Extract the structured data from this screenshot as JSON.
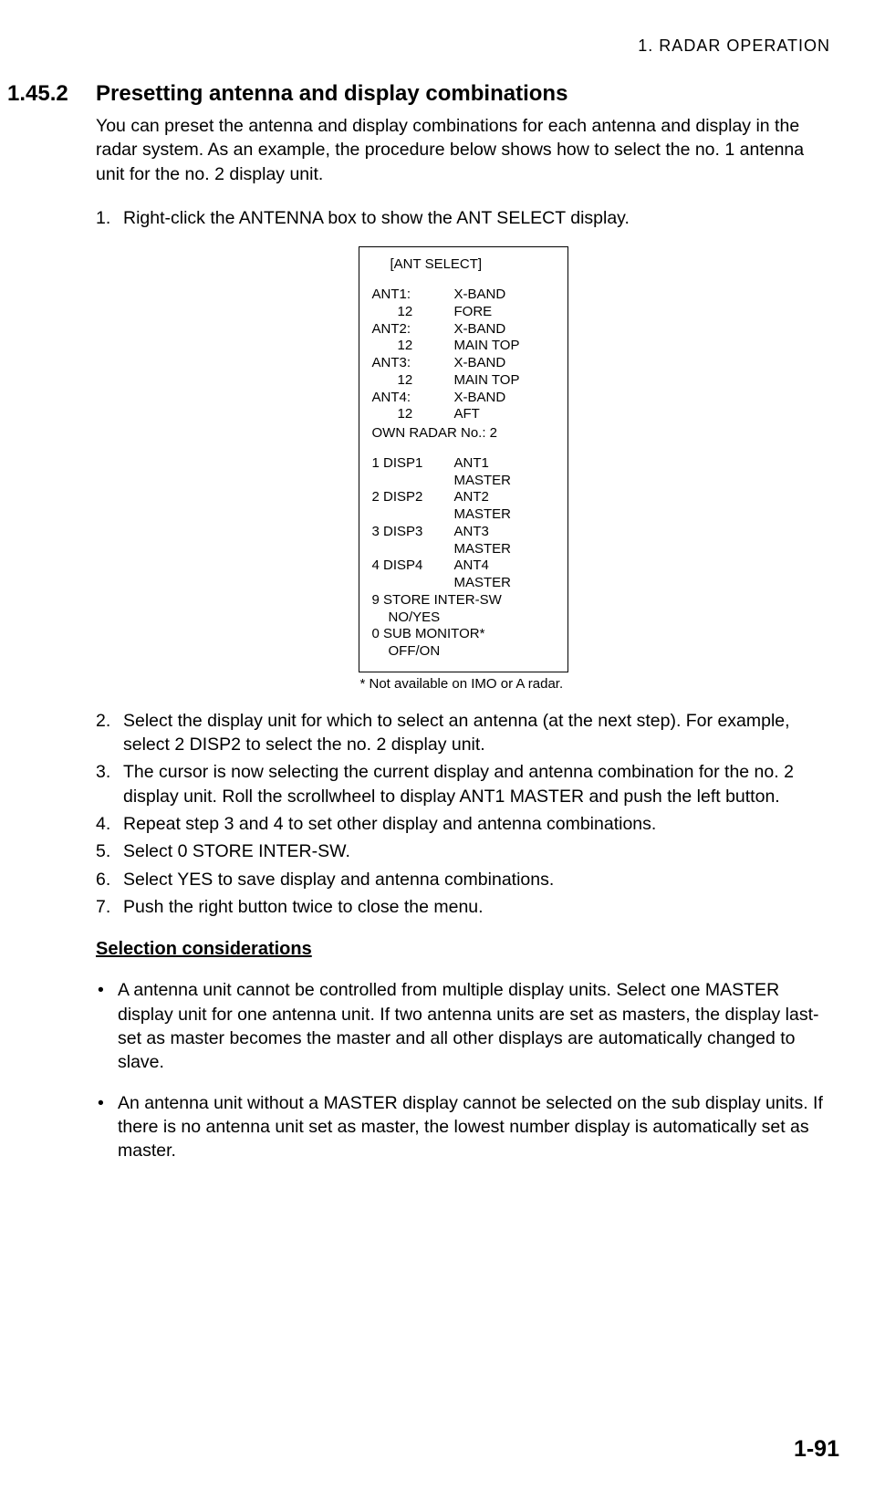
{
  "header": "1.  RADAR  OPERATION",
  "section": {
    "number": "1.45.2",
    "title": "Presetting antenna and display combinations"
  },
  "intro": "You can preset the antenna and display combinations for each antenna and display in the radar system. As an example, the procedure below shows how to select the no. 1 antenna unit for the no. 2 display unit.",
  "steps": [
    "Right-click the ANTENNA box to show the ANT SELECT display.",
    "Select the display unit for which to select an antenna (at the next step). For example, select 2 DISP2 to select the no. 2 display unit.",
    "The cursor is now selecting the current display and antenna combination for the no. 2 display unit. Roll the scrollwheel to display ANT1 MASTER and push the left button.",
    "Repeat step 3 and 4 to set other display and antenna combinations.",
    "Select 0 STORE INTER-SW.",
    "Select YES to save display and antenna combinations.",
    "Push the right button twice to close the menu."
  ],
  "diagram": {
    "title": "[ANT SELECT]",
    "ants": [
      {
        "label": "ANT1:",
        "band": "X-BAND",
        "num": "12",
        "loc": "FORE"
      },
      {
        "label": "ANT2:",
        "band": "X-BAND",
        "num": "12",
        "loc": "MAIN TOP"
      },
      {
        "label": "ANT3:",
        "band": "X-BAND",
        "num": "12",
        "loc": "MAIN  TOP"
      },
      {
        "label": "ANT4:",
        "band": "X-BAND",
        "num": "12",
        "loc": "AFT"
      }
    ],
    "own": "OWN RADAR No.: 2",
    "disps": [
      {
        "label": "1 DISP1",
        "ant": "ANT1",
        "mode": "MASTER"
      },
      {
        "label": "2 DISP2",
        "ant": "ANT2",
        "mode": "MASTER"
      },
      {
        "label": "3 DISP3",
        "ant": "ANT3",
        "mode": "MASTER"
      },
      {
        "label": "4 DISP4",
        "ant": "ANT4",
        "mode": "MASTER"
      }
    ],
    "store1": "9 STORE INTER-SW",
    "store2": "NO/YES",
    "sub1": "0 SUB MONITOR*",
    "sub2": "OFF/ON"
  },
  "footnote": "* Not available on IMO or A radar.",
  "subhead": "Selection considerations",
  "bullets": [
    "A antenna unit cannot be controlled from multiple display units. Select one MASTER display unit for one antenna unit. If two antenna units are set as masters, the display last-set as master becomes the master and all other displays are automatically changed to slave.",
    "An antenna unit without a MASTER display cannot be selected on the sub display units. If there is no antenna unit set as master, the lowest number display is automatically set as master."
  ],
  "pageNum": "1-91"
}
